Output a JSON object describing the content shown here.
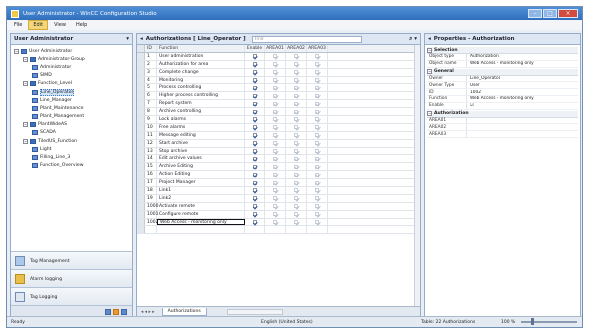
{
  "window": {
    "title": "User Administrator - WinCC Configuration Studio",
    "buttons": [
      "–",
      "□",
      "×"
    ]
  },
  "menu": [
    "File",
    "Edit",
    "View",
    "Help"
  ],
  "left": {
    "title": "User Administrator",
    "tree": [
      {
        "label": "User Administrator",
        "level": 0,
        "icon": "admin",
        "tog": "−"
      },
      {
        "label": "Administrator-Group",
        "level": 1,
        "icon": "grp",
        "tog": "−"
      },
      {
        "label": "Administrator",
        "level": 2,
        "icon": "usr"
      },
      {
        "label": "SIMD",
        "level": 2,
        "icon": "usr"
      },
      {
        "label": "Function_Level",
        "level": 1,
        "icon": "grp",
        "tog": "−"
      },
      {
        "label": "Line_Operator",
        "level": 2,
        "icon": "usr",
        "sel": true
      },
      {
        "label": "Line_Manager",
        "level": 2,
        "icon": "usr"
      },
      {
        "label": "Plant_Maintenance",
        "level": 2,
        "icon": "usr"
      },
      {
        "label": "Plant_Management",
        "level": 2,
        "icon": "usr"
      },
      {
        "label": "PlantWideAS",
        "level": 1,
        "icon": "grp",
        "tog": "−"
      },
      {
        "label": "SCADA",
        "level": 2,
        "icon": "usr"
      },
      {
        "label": "TiledUS_Function",
        "level": 1,
        "icon": "grp",
        "tog": "−"
      },
      {
        "label": "Light",
        "level": 2,
        "icon": "usr"
      },
      {
        "label": "Filling_Line_3",
        "level": 2,
        "icon": "usr"
      },
      {
        "label": "Function_Overview",
        "level": 2,
        "icon": "usr"
      }
    ],
    "nav": [
      "Tag Management",
      "Alarm logging",
      "Tag Logging"
    ]
  },
  "center": {
    "title": "Authorizations [ Line_Operator ]",
    "search_placeholder": "Find",
    "columns": [
      "ID",
      "Function",
      "Enable",
      "AREA01",
      "AREA02",
      "AREA03"
    ],
    "rows": [
      {
        "id": "1",
        "fn": "User administration",
        "en": true
      },
      {
        "id": "2",
        "fn": "Authorization for area",
        "en": true
      },
      {
        "id": "3",
        "fn": "Complete change",
        "en": true
      },
      {
        "id": "4",
        "fn": "Monitoring",
        "en": true
      },
      {
        "id": "5",
        "fn": "Process controlling",
        "en": true
      },
      {
        "id": "6",
        "fn": "Higher process controlling",
        "en": true
      },
      {
        "id": "7",
        "fn": "Report system",
        "en": true
      },
      {
        "id": "8",
        "fn": "Archive controlling",
        "en": true
      },
      {
        "id": "9",
        "fn": "Lock alarms",
        "en": true
      },
      {
        "id": "10",
        "fn": "Free alarms",
        "en": true
      },
      {
        "id": "11",
        "fn": "Message editing",
        "en": true
      },
      {
        "id": "12",
        "fn": "Start archive",
        "en": true
      },
      {
        "id": "13",
        "fn": "Stop archive",
        "en": true
      },
      {
        "id": "14",
        "fn": "Edit archive values",
        "en": true
      },
      {
        "id": "15",
        "fn": "Archive Editing",
        "en": true
      },
      {
        "id": "16",
        "fn": "Action Editing",
        "en": true
      },
      {
        "id": "17",
        "fn": "Project Manager",
        "en": true
      },
      {
        "id": "18",
        "fn": "Link1",
        "en": true
      },
      {
        "id": "19",
        "fn": "Link2",
        "en": true
      },
      {
        "id": "1000",
        "fn": "Activate remote",
        "en": true
      },
      {
        "id": "1001",
        "fn": "Configure remote",
        "en": true
      },
      {
        "id": "1002",
        "fn": "Web Access - monitoring only",
        "en": true,
        "edit": true
      }
    ],
    "tab": "Authorizations",
    "tab_arrows": "◂ ◂ ▸ ▸"
  },
  "right": {
    "title": "Properties - Authorization",
    "sections": [
      {
        "name": "Selection",
        "rows": [
          [
            "Object type",
            "Authorization"
          ],
          [
            "Object name",
            "Web Access - monitoring only"
          ]
        ]
      },
      {
        "name": "General",
        "rows": [
          [
            "Owner",
            "Line_Operator"
          ],
          [
            "Owner Type",
            "User"
          ],
          [
            "ID",
            "1002"
          ],
          [
            "Function",
            "Web Access - monitoring only"
          ],
          [
            "Enable",
            "☑"
          ]
        ]
      },
      {
        "name": "Authorization",
        "rows": [
          [
            "AREA01",
            ""
          ],
          [
            "AREA02",
            ""
          ],
          [
            "AREA03",
            ""
          ]
        ]
      }
    ]
  },
  "status": {
    "ready": "Ready",
    "lang": "English (United States)",
    "count": "Table: 22 Authorizations",
    "zoom": "100 %"
  }
}
